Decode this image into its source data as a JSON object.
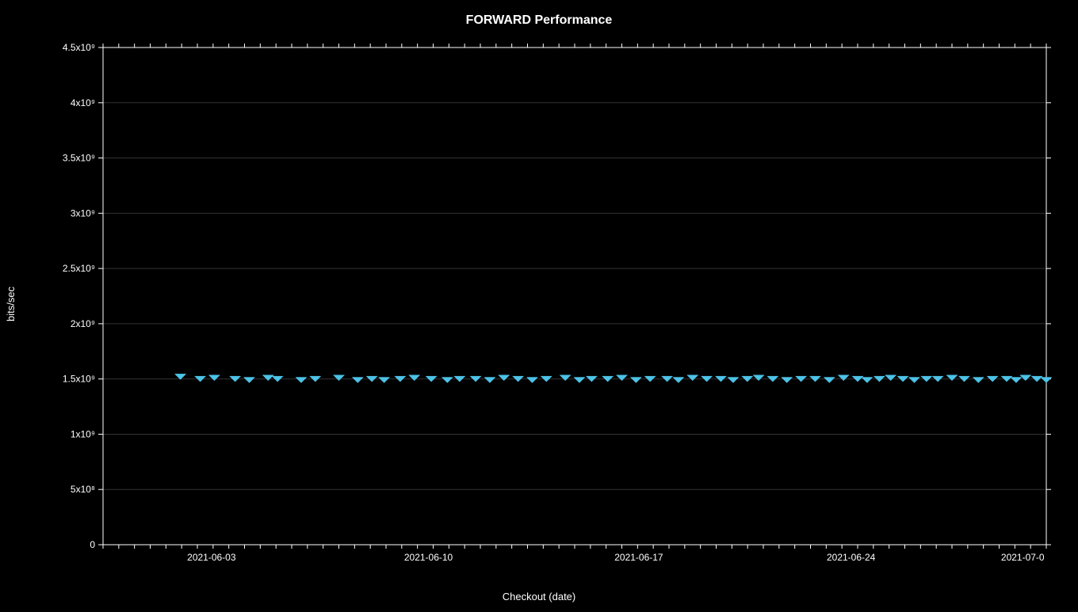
{
  "chart": {
    "title": "FORWARD Performance",
    "x_axis_label": "Checkout (date)",
    "y_axis_label": "bits/sec",
    "y_ticks": [
      {
        "label": "0",
        "value": 0
      },
      {
        "label": "5x10⁸",
        "value": 500000000
      },
      {
        "label": "1x10⁹",
        "value": 1000000000
      },
      {
        "label": "1.5x10⁹",
        "value": 1500000000
      },
      {
        "label": "2x10⁹",
        "value": 2000000000
      },
      {
        "label": "2.5x10⁹",
        "value": 2500000000
      },
      {
        "label": "3x10⁹",
        "value": 3000000000
      },
      {
        "label": "3.5x10⁹",
        "value": 3500000000
      },
      {
        "label": "4x10⁹",
        "value": 4000000000
      },
      {
        "label": "4.5x10⁹",
        "value": 4500000000
      }
    ],
    "x_ticks": [
      {
        "label": "2021-06-03",
        "pos": 0.12
      },
      {
        "label": "2021-06-10",
        "pos": 0.35
      },
      {
        "label": "2021-06-17",
        "pos": 0.57
      },
      {
        "label": "2021-06-24",
        "pos": 0.79
      },
      {
        "label": "2021-07-0",
        "pos": 0.97
      }
    ],
    "data_color": "#4dc3e8",
    "data_points": [
      {
        "x": 0.082,
        "y": 1520000000.0
      },
      {
        "x": 0.103,
        "y": 1500000000.0
      },
      {
        "x": 0.118,
        "y": 1510000000.0
      },
      {
        "x": 0.14,
        "y": 1500000000.0
      },
      {
        "x": 0.155,
        "y": 1490000000.0
      },
      {
        "x": 0.175,
        "y": 1510000000.0
      },
      {
        "x": 0.185,
        "y": 1500000000.0
      },
      {
        "x": 0.21,
        "y": 1490000000.0
      },
      {
        "x": 0.225,
        "y": 1500000000.0
      },
      {
        "x": 0.25,
        "y": 1510000000.0
      },
      {
        "x": 0.27,
        "y": 1490000000.0
      },
      {
        "x": 0.285,
        "y": 1500000000.0
      },
      {
        "x": 0.298,
        "y": 1490000000.0
      },
      {
        "x": 0.315,
        "y": 1500000000.0
      },
      {
        "x": 0.33,
        "y": 1510000000.0
      },
      {
        "x": 0.348,
        "y": 1500000000.0
      },
      {
        "x": 0.365,
        "y": 1490000000.0
      },
      {
        "x": 0.378,
        "y": 1500000000.0
      },
      {
        "x": 0.395,
        "y": 1500000000.0
      },
      {
        "x": 0.41,
        "y": 1490000000.0
      },
      {
        "x": 0.425,
        "y": 1510000000.0
      },
      {
        "x": 0.44,
        "y": 1500000000.0
      },
      {
        "x": 0.455,
        "y": 1490000000.0
      },
      {
        "x": 0.47,
        "y": 1500000000.0
      },
      {
        "x": 0.49,
        "y": 1510000000.0
      },
      {
        "x": 0.505,
        "y": 1490000000.0
      },
      {
        "x": 0.518,
        "y": 1500000000.0
      },
      {
        "x": 0.535,
        "y": 1500000000.0
      },
      {
        "x": 0.55,
        "y": 1510000000.0
      },
      {
        "x": 0.565,
        "y": 1490000000.0
      },
      {
        "x": 0.58,
        "y": 1500000000.0
      },
      {
        "x": 0.598,
        "y": 1500000000.0
      },
      {
        "x": 0.61,
        "y": 1490000000.0
      },
      {
        "x": 0.625,
        "y": 1510000000.0
      },
      {
        "x": 0.64,
        "y": 1500000000.0
      },
      {
        "x": 0.655,
        "y": 1500000000.0
      },
      {
        "x": 0.668,
        "y": 1490000000.0
      },
      {
        "x": 0.683,
        "y": 1500000000.0
      },
      {
        "x": 0.695,
        "y": 1510000000.0
      },
      {
        "x": 0.71,
        "y": 1500000000.0
      },
      {
        "x": 0.725,
        "y": 1490000000.0
      },
      {
        "x": 0.74,
        "y": 1500000000.0
      },
      {
        "x": 0.755,
        "y": 1500000000.0
      },
      {
        "x": 0.77,
        "y": 1490000000.0
      },
      {
        "x": 0.785,
        "y": 1510000000.0
      },
      {
        "x": 0.8,
        "y": 1500000000.0
      },
      {
        "x": 0.81,
        "y": 1490000000.0
      },
      {
        "x": 0.823,
        "y": 1500000000.0
      },
      {
        "x": 0.835,
        "y": 1510000000.0
      },
      {
        "x": 0.848,
        "y": 1500000000.0
      },
      {
        "x": 0.86,
        "y": 1490000000.0
      },
      {
        "x": 0.873,
        "y": 1500000000.0
      },
      {
        "x": 0.885,
        "y": 1500000000.0
      },
      {
        "x": 0.9,
        "y": 1510000000.0
      },
      {
        "x": 0.913,
        "y": 1500000000.0
      },
      {
        "x": 0.928,
        "y": 1490000000.0
      },
      {
        "x": 0.943,
        "y": 1500000000.0
      },
      {
        "x": 0.958,
        "y": 1500000000.0
      },
      {
        "x": 0.968,
        "y": 1490000000.0
      },
      {
        "x": 0.978,
        "y": 1510000000.0
      },
      {
        "x": 0.99,
        "y": 1500000000.0
      },
      {
        "x": 1.0,
        "y": 1490000000.0
      }
    ]
  }
}
